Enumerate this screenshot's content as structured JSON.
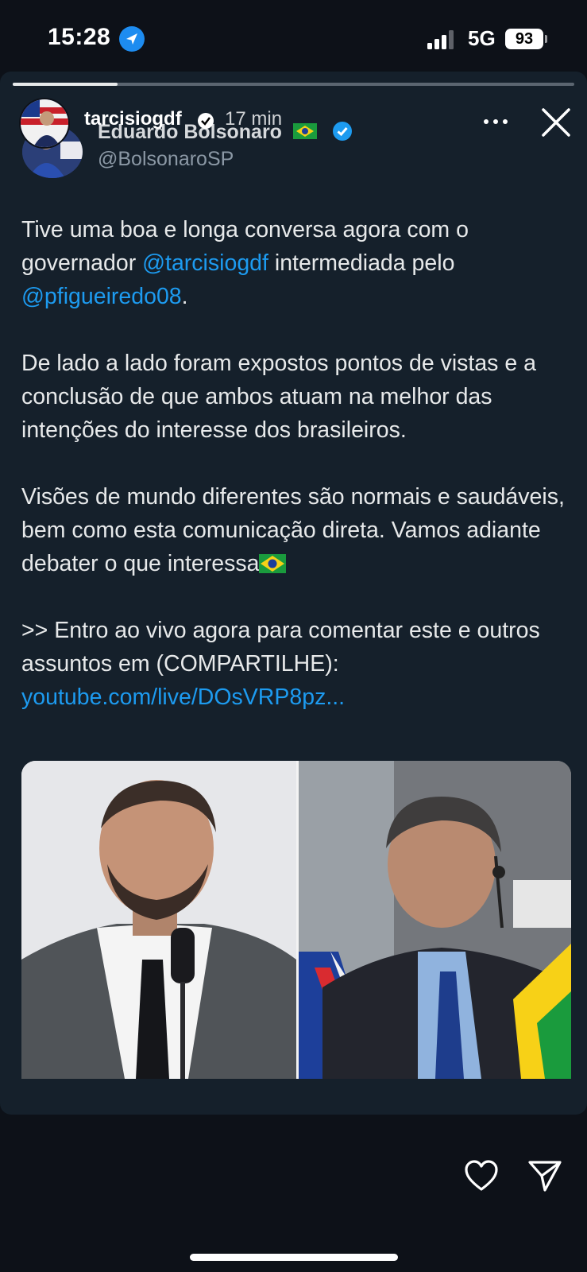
{
  "status_bar": {
    "time": "15:28",
    "network": "5G",
    "battery": "93"
  },
  "story": {
    "username": "tarcisiogdf",
    "time_ago": "17 min",
    "progress": 0.17
  },
  "tweet": {
    "name": "Eduardo Bolsonaro",
    "handle": "@BolsonaroSP",
    "p1_a": "Tive uma boa e longa conversa agora com o governador ",
    "p1_mention1": "@tarcisiogdf",
    "p1_b": " intermediada pelo ",
    "p1_mention2": "@pfigueiredo08",
    "p1_c": ".",
    "p2": "De lado a lado foram expostos pontos de vistas e a conclusão de que ambos atuam na melhor das intenções do interesse dos brasileiros.",
    "p3": "Visões de mundo diferentes são normais e saudáveis, bem como esta comunicação direta. Vamos adiante debater o que interessa",
    "p4": ">> Entro ao vivo agora para comentar este e outros assuntos em (COMPARTILHE):",
    "link": "youtube.com/live/DOsVRP8pz..."
  },
  "icons": {
    "location": "location-arrow-icon",
    "more": "more-horizontal-icon",
    "close": "close-icon",
    "like": "heart-icon",
    "share": "paper-plane-icon",
    "verified": "verified-badge-icon",
    "flag": "brazil-flag-icon"
  },
  "colors": {
    "background": "#0d1118",
    "card": "#15202b",
    "link": "#1d9bf0",
    "text": "#e7e9ea",
    "muted": "#8b98a5"
  }
}
